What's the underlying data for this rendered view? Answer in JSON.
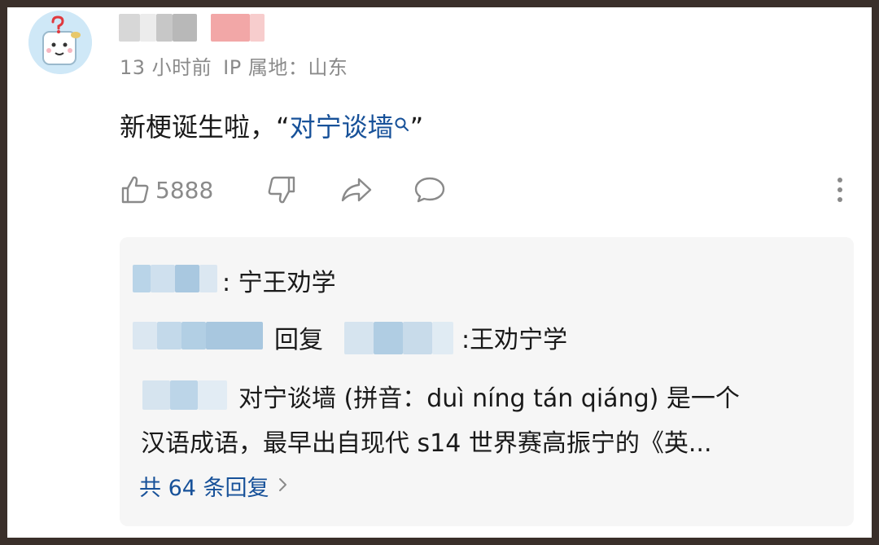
{
  "comment": {
    "timestamp": "13 小时前",
    "ip_location": "IP 属地：山东",
    "text_prefix": "新梗诞生啦，“",
    "link_text": "对宁谈墙",
    "text_suffix": "”",
    "likes": "5888"
  },
  "replies": {
    "items": [
      {
        "text": ": 宁王劝学"
      },
      {
        "verb": "回复",
        "text": ":王劝宁学"
      },
      {
        "line1": "对宁谈墙 (拼音：duì níng tán qiáng) 是一个",
        "line2": "汉语成语，最早出自现代 s14 世界赛高振宁的《英..."
      }
    ],
    "more_label": "共 64 条回复"
  },
  "icons": [
    "avatar",
    "search-icon",
    "thumbs-up-icon",
    "thumbs-down-icon",
    "share-icon",
    "comment-icon",
    "more-icon",
    "chevron-right-icon"
  ],
  "colors": {
    "link": "#175199",
    "meta": "#8a8a8a",
    "reply_bg": "#f6f6f6",
    "frame": "#3a2f2a"
  }
}
